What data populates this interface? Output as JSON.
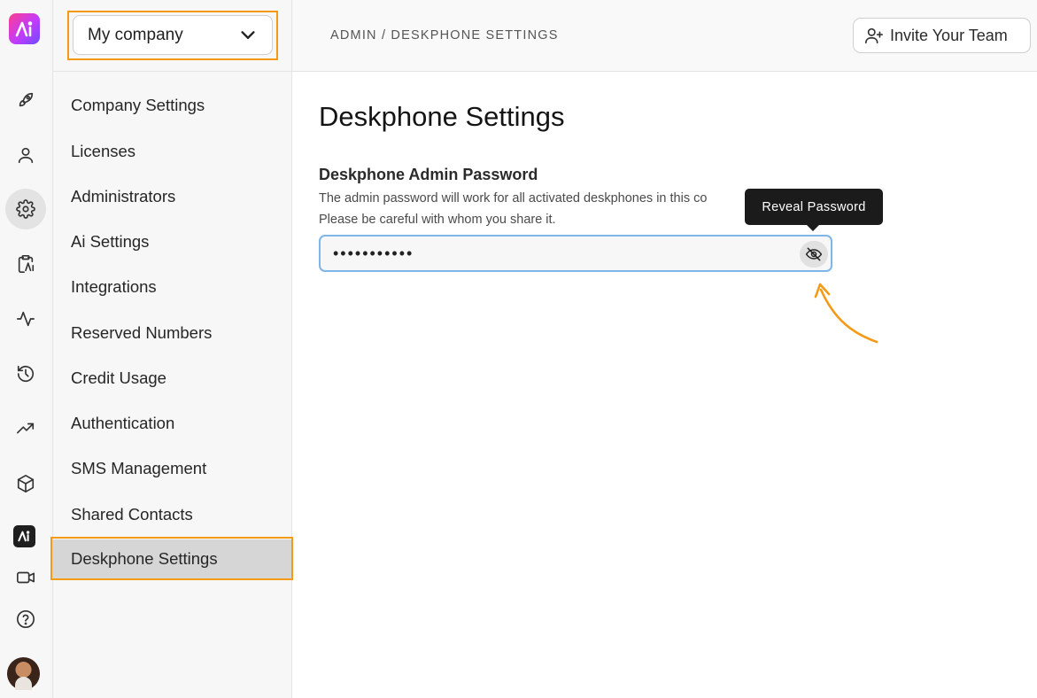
{
  "colors": {
    "highlight": "#f59a16",
    "focus_border": "#7fb6ea",
    "active_nav_bg": "#d6d6d6",
    "tooltip_bg": "#1b1b1b"
  },
  "rail": {
    "items": [
      {
        "icon": "rocket-icon"
      },
      {
        "icon": "user-icon"
      },
      {
        "icon": "gear-icon",
        "active": true
      },
      {
        "icon": "clipboard-icon"
      },
      {
        "icon": "activity-icon"
      },
      {
        "icon": "history-icon"
      },
      {
        "icon": "trending-up-icon"
      },
      {
        "icon": "cube-icon"
      },
      {
        "icon": "brand-logo-icon"
      },
      {
        "icon": "video-icon"
      },
      {
        "icon": "help-icon"
      },
      {
        "icon": "avatar"
      }
    ]
  },
  "company_select": {
    "value": "My company"
  },
  "sidebar": {
    "items": [
      {
        "label": "Company Settings"
      },
      {
        "label": "Licenses"
      },
      {
        "label": "Administrators"
      },
      {
        "label": "Ai Settings"
      },
      {
        "label": "Integrations"
      },
      {
        "label": "Reserved Numbers"
      },
      {
        "label": "Credit Usage"
      },
      {
        "label": "Authentication"
      },
      {
        "label": "SMS Management"
      },
      {
        "label": "Shared Contacts"
      },
      {
        "label": "Deskphone Settings",
        "active": true
      }
    ]
  },
  "header": {
    "breadcrumb": "ADMIN / DESKPHONE SETTINGS",
    "invite_label": "Invite Your Team"
  },
  "main": {
    "title": "Deskphone Settings",
    "field_label": "Deskphone Admin Password",
    "help_line1": "The admin password will work for all activated deskphones in this co",
    "help_line2": "Please be careful with whom you share it.",
    "password_masked": "•••••••••••",
    "tooltip": "Reveal Password"
  }
}
